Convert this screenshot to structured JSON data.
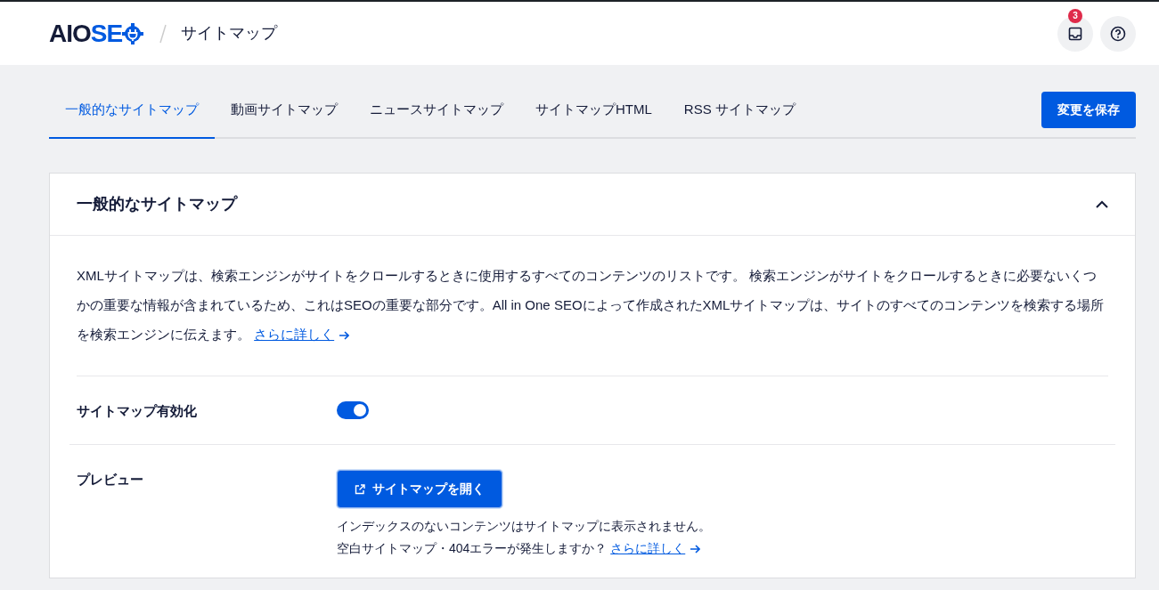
{
  "header": {
    "logo": {
      "dark": "AIO",
      "accent": "SE"
    },
    "breadcrumb": "サイトマップ",
    "notifications": {
      "count": "3"
    }
  },
  "tabs": [
    {
      "label": "一般的なサイトマップ",
      "selected": true
    },
    {
      "label": "動画サイトマップ",
      "selected": false
    },
    {
      "label": "ニュースサイトマップ",
      "selected": false
    },
    {
      "label": "サイトマップHTML",
      "selected": false
    },
    {
      "label": "RSS サイトマップ",
      "selected": false
    }
  ],
  "save_button": "変更を保存",
  "card": {
    "title": "一般的なサイトマップ",
    "expanded": true,
    "description": "XMLサイトマップは、検索エンジンがサイトをクロールするときに使用するすべてのコンテンツのリストです。 検索エンジンがサイトをクロールするときに必要ないくつかの重要な情報が含まれているため、これはSEOの重要な部分です。All in One SEOによって作成されたXMLサイトマップは、サイトのすべてのコンテンツを検索する場所を検索エンジンに伝えます。",
    "description_link": "さらに詳しく",
    "settings": [
      {
        "kind": "toggle",
        "label": "サイトマップ有効化",
        "on": true
      },
      {
        "kind": "button",
        "label": "プレビュー",
        "button": "サイトマップを開く",
        "notes": [
          "インデックスのないコンテンツはサイトマップに表示されません。",
          "空白サイトマップ・404エラーが発生しますか？"
        ],
        "note_link": "さらに詳しく"
      }
    ]
  }
}
